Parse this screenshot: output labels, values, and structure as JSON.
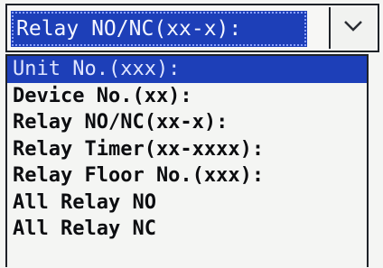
{
  "combo": {
    "selected_value": "Relay NO/NC(xx-x):",
    "dropdown_icon": "chevron-down-icon"
  },
  "options": [
    {
      "label": "Unit No.(xxx):",
      "selected": true
    },
    {
      "label": "Device No.(xx):",
      "selected": false
    },
    {
      "label": "Relay NO/NC(xx-x):",
      "selected": false
    },
    {
      "label": "Relay Timer(xx-xxxx):",
      "selected": false
    },
    {
      "label": "Relay Floor No.(xxx):",
      "selected": false
    },
    {
      "label": "All Relay NO",
      "selected": false
    },
    {
      "label": "All Relay NC",
      "selected": false
    }
  ],
  "colors": {
    "highlight": "#1d3fb8",
    "text": "#0c0d10",
    "background": "#f4f5f3"
  }
}
